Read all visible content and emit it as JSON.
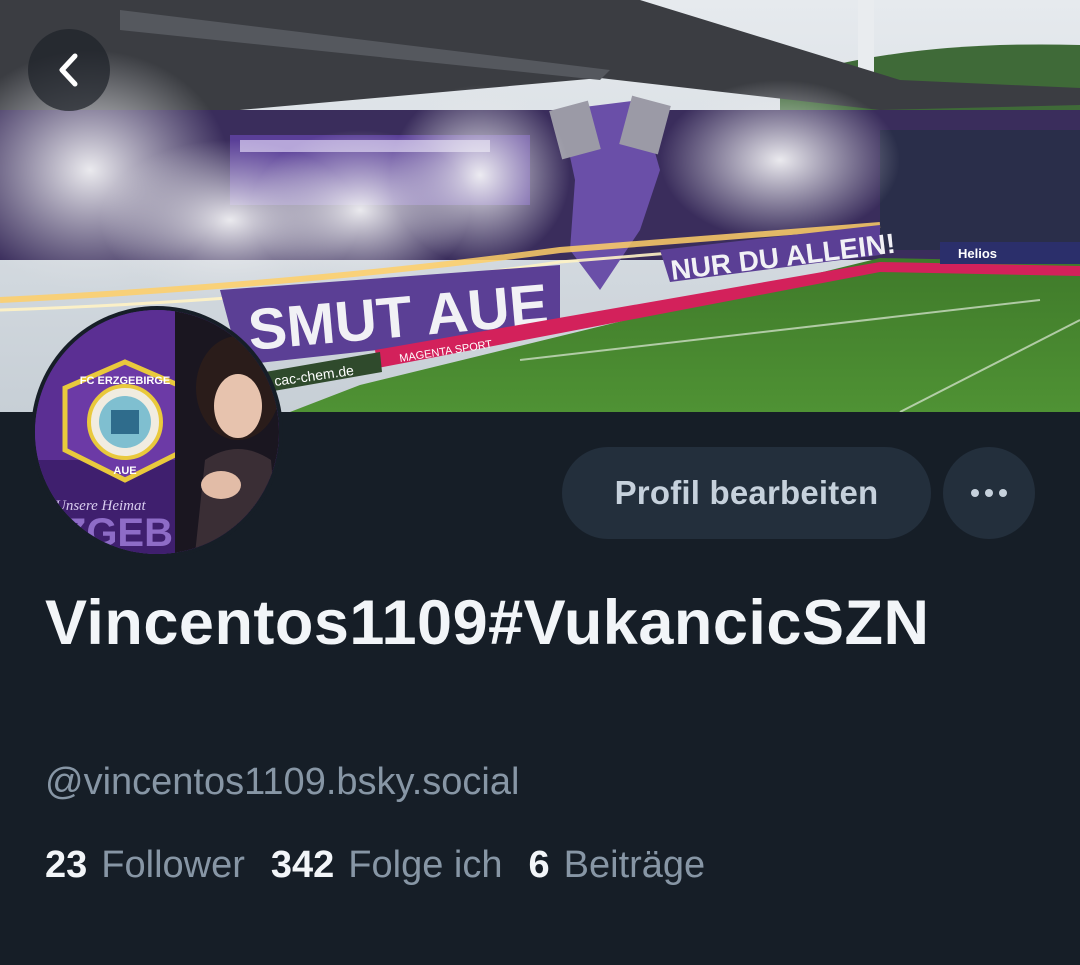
{
  "banner": {
    "tifo_text_left": "SMUT AUE",
    "tifo_text_right": "NUR DU ALLEIN!",
    "sponsor_1": "MAGENTA SPORT",
    "sponsor_2": "cac-chem.de",
    "sponsor_3": "Helios"
  },
  "avatar": {
    "crest_top": "FC ERZGEBIRGE",
    "crest_bottom": "AUE",
    "crest_lower_text": "Unsere Heimat",
    "crest_lower_big": "RZGEB"
  },
  "actions": {
    "edit_profile": "Profil bearbeiten",
    "more_label": "···"
  },
  "profile": {
    "display_name": "Vincentos1109#VukancicSZN",
    "handle": "@vincentos1109.bsky.social"
  },
  "stats": {
    "followers_count": "23",
    "followers_label": "Follower",
    "following_count": "342",
    "following_label": "Folge ich",
    "posts_count": "6",
    "posts_label": "Beiträge"
  },
  "colors": {
    "background": "#161e27",
    "button_bg": "#232f3c",
    "text_primary": "#f2f5f8",
    "text_secondary": "#8796a5",
    "club_purple": "#5b2f93"
  }
}
